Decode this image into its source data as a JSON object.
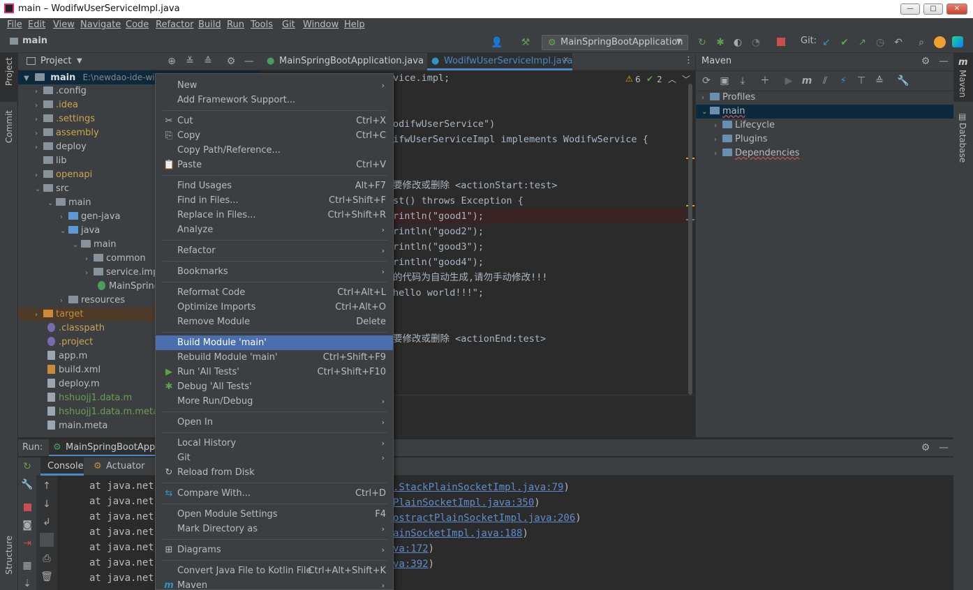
{
  "window": {
    "title": "main – WodifwUserServiceImpl.java",
    "min": "—",
    "max": "□",
    "close": "✕"
  },
  "menubar": [
    "File",
    "Edit",
    "View",
    "Navigate",
    "Code",
    "Refactor",
    "Build",
    "Run",
    "Tools",
    "Git",
    "Window",
    "Help"
  ],
  "navbar": {
    "breadcrumb": "main",
    "run_config": "MainSpringBootApplication",
    "git_label": "Git:"
  },
  "leftstripe": {
    "project": "Project",
    "commit": "Commit",
    "structure": "Structure"
  },
  "rightstripe": {
    "maven": "Maven",
    "database": "Database"
  },
  "project": {
    "title": "Project",
    "root": {
      "name": "main",
      "path": "E:\\newdao-ide-wind"
    },
    "items": [
      {
        "label": ".config",
        "kind": "folder"
      },
      {
        "label": ".idea",
        "kind": "folder"
      },
      {
        "label": ".settings",
        "kind": "folder"
      },
      {
        "label": "assembly",
        "kind": "folder"
      },
      {
        "label": "deploy",
        "kind": "folder"
      },
      {
        "label": "lib",
        "kind": "folder"
      },
      {
        "label": "openapi",
        "kind": "folder"
      },
      {
        "label": "src",
        "kind": "folder"
      },
      {
        "label": "main",
        "kind": "folder"
      },
      {
        "label": "gen-java",
        "kind": "folder"
      },
      {
        "label": "java",
        "kind": "folder"
      },
      {
        "label": "main",
        "kind": "package"
      },
      {
        "label": "common",
        "kind": "package"
      },
      {
        "label": "service.imp",
        "kind": "package"
      },
      {
        "label": "MainSpring",
        "kind": "class"
      },
      {
        "label": "resources",
        "kind": "folder"
      },
      {
        "label": "target",
        "kind": "folder"
      },
      {
        "label": ".classpath",
        "kind": "file"
      },
      {
        "label": ".project",
        "kind": "file"
      },
      {
        "label": "app.m",
        "kind": "file"
      },
      {
        "label": "build.xml",
        "kind": "file"
      },
      {
        "label": "deploy.m",
        "kind": "file"
      },
      {
        "label": "hshuojj1.data.m",
        "kind": "file"
      },
      {
        "label": "hshuojj1.data.m.meta",
        "kind": "file"
      },
      {
        "label": "main.meta",
        "kind": "file"
      }
    ]
  },
  "editor": {
    "tabs": [
      "MainSpringBootApplication.java",
      "WodifwUserServiceImpl.java"
    ],
    "warnings": "6",
    "checks": "2",
    "lines": [
      {
        "text": "vice.impl;",
        "hl": false
      },
      {
        "text": "",
        "hl": false
      },
      {
        "text": "",
        "hl": false
      },
      {
        "text": "odifwUserService\")",
        "hl": false
      },
      {
        "text": "ifwUserServiceImpl implements WodifwService {",
        "hl": false
      },
      {
        "text": "",
        "hl": false
      },
      {
        "text": "",
        "hl": false
      },
      {
        "text": "要修改或删除 <actionStart:test>",
        "hl": false
      },
      {
        "text": "st() throws Exception {",
        "hl": false
      },
      {
        "text": "rintln(\"good1\");",
        "hl": true
      },
      {
        "text": "rintln(\"good2\");",
        "hl": false
      },
      {
        "text": "rintln(\"good3\");",
        "hl": false
      },
      {
        "text": "rintln(\"good4\");",
        "hl": false
      },
      {
        "text": "的代码为自动生成,请勿手动修改!!!",
        "hl": false
      },
      {
        "text": "hello world!!!\";",
        "hl": false
      },
      {
        "text": "",
        "hl": false
      },
      {
        "text": "",
        "hl": false
      },
      {
        "text": "要修改或删除 <actionEnd:test>",
        "hl": false
      }
    ]
  },
  "maven": {
    "title": "Maven",
    "tree": [
      {
        "label": "Profiles",
        "indent": 0
      },
      {
        "label": "main",
        "indent": 0
      },
      {
        "label": "Lifecycle",
        "indent": 1
      },
      {
        "label": "Plugins",
        "indent": 1
      },
      {
        "label": "Dependencies",
        "indent": 1
      }
    ]
  },
  "run": {
    "label": "Run:",
    "config": "MainSpringBootAppli",
    "tabs": [
      "Console",
      "Actuator"
    ],
    "console_prefix": [
      "at java.net.",
      "at java.net.",
      "at java.net.",
      "at java.net.",
      "at java.net.",
      "at java.net.",
      "at java.net."
    ],
    "console_links": [
      ".StackPlainSocketImpl.java:79",
      "PlainSocketImpl.java:350",
      "ostractPlainSocketImpl.java:206",
      "ainSocketImpl.java:188",
      "va:172",
      "va:392"
    ]
  },
  "context_menu": [
    {
      "label": "New",
      "shortcut": "",
      "submenu": true,
      "icon": ""
    },
    {
      "label": "Add Framework Support...",
      "shortcut": "",
      "submenu": false,
      "icon": ""
    },
    {
      "sep": true
    },
    {
      "label": "Cut",
      "shortcut": "Ctrl+X",
      "submenu": false,
      "icon": "✂"
    },
    {
      "label": "Copy",
      "shortcut": "Ctrl+C",
      "submenu": false,
      "icon": "⎘"
    },
    {
      "label": "Copy Path/Reference...",
      "shortcut": "",
      "submenu": false,
      "icon": ""
    },
    {
      "label": "Paste",
      "shortcut": "Ctrl+V",
      "submenu": false,
      "icon": "📋"
    },
    {
      "sep": true
    },
    {
      "label": "Find Usages",
      "shortcut": "Alt+F7",
      "submenu": false,
      "icon": ""
    },
    {
      "label": "Find in Files...",
      "shortcut": "Ctrl+Shift+F",
      "submenu": false,
      "icon": ""
    },
    {
      "label": "Replace in Files...",
      "shortcut": "Ctrl+Shift+R",
      "submenu": false,
      "icon": ""
    },
    {
      "label": "Analyze",
      "shortcut": "",
      "submenu": true,
      "icon": ""
    },
    {
      "sep": true
    },
    {
      "label": "Refactor",
      "shortcut": "",
      "submenu": true,
      "icon": ""
    },
    {
      "sep": true
    },
    {
      "label": "Bookmarks",
      "shortcut": "",
      "submenu": true,
      "icon": ""
    },
    {
      "sep": true
    },
    {
      "label": "Reformat Code",
      "shortcut": "Ctrl+Alt+L",
      "submenu": false,
      "icon": ""
    },
    {
      "label": "Optimize Imports",
      "shortcut": "Ctrl+Alt+O",
      "submenu": false,
      "icon": ""
    },
    {
      "label": "Remove Module",
      "shortcut": "Delete",
      "submenu": false,
      "icon": ""
    },
    {
      "sep": true
    },
    {
      "label": "Build Module 'main'",
      "shortcut": "",
      "submenu": false,
      "icon": "",
      "selected": true
    },
    {
      "label": "Rebuild Module 'main'",
      "shortcut": "Ctrl+Shift+F9",
      "submenu": false,
      "icon": ""
    },
    {
      "label": "Run 'All Tests'",
      "shortcut": "Ctrl+Shift+F10",
      "submenu": false,
      "icon": "▶"
    },
    {
      "label": "Debug 'All Tests'",
      "shortcut": "",
      "submenu": false,
      "icon": "✱"
    },
    {
      "label": "More Run/Debug",
      "shortcut": "",
      "submenu": true,
      "icon": ""
    },
    {
      "sep": true
    },
    {
      "label": "Open In",
      "shortcut": "",
      "submenu": true,
      "icon": ""
    },
    {
      "sep": true
    },
    {
      "label": "Local History",
      "shortcut": "",
      "submenu": true,
      "icon": ""
    },
    {
      "label": "Git",
      "shortcut": "",
      "submenu": true,
      "icon": ""
    },
    {
      "label": "Reload from Disk",
      "shortcut": "",
      "submenu": false,
      "icon": "↻"
    },
    {
      "sep": true
    },
    {
      "label": "Compare With...",
      "shortcut": "Ctrl+D",
      "submenu": false,
      "icon": "⇆"
    },
    {
      "sep": true
    },
    {
      "label": "Open Module Settings",
      "shortcut": "F4",
      "submenu": false,
      "icon": ""
    },
    {
      "label": "Mark Directory as",
      "shortcut": "",
      "submenu": true,
      "icon": ""
    },
    {
      "sep": true
    },
    {
      "label": "Diagrams",
      "shortcut": "",
      "submenu": true,
      "icon": "⊞"
    },
    {
      "sep": true
    },
    {
      "label": "Convert Java File to Kotlin File",
      "shortcut": "Ctrl+Alt+Shift+K",
      "submenu": false,
      "icon": ""
    },
    {
      "label": "Maven",
      "shortcut": "",
      "submenu": true,
      "icon": "m"
    }
  ]
}
